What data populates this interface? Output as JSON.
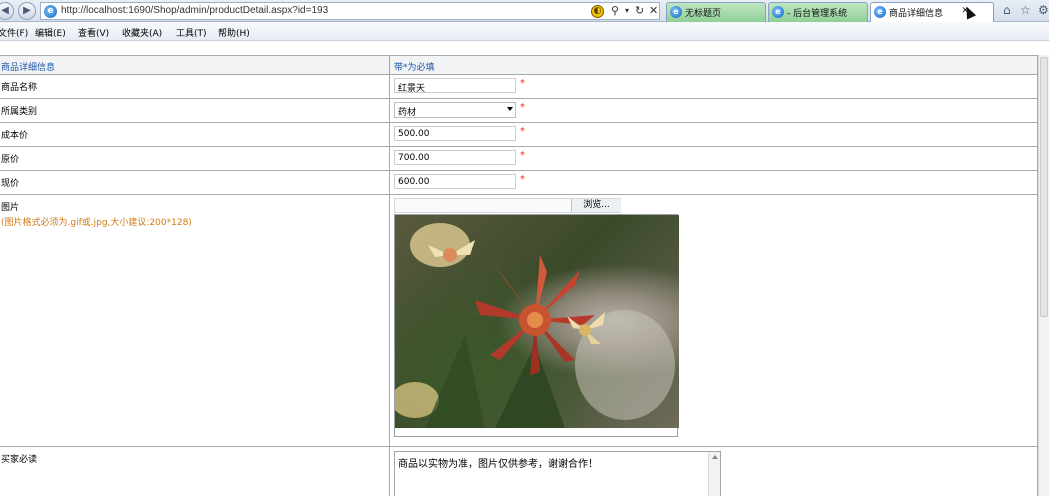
{
  "browser": {
    "url": "http://localhost:1690/Shop/admin/productDetail.aspx?id=193",
    "tabs": [
      {
        "label": "无标题页"
      },
      {
        "label": "- 后台管理系统"
      },
      {
        "label": "商品详细信息"
      }
    ],
    "menu": [
      "文件(F)",
      "编辑(E)",
      "查看(V)",
      "收藏夹(A)",
      "工具(T)",
      "帮助(H)"
    ]
  },
  "form": {
    "header_left": "商品详细信息",
    "header_right": "带*为必填",
    "required_mark": "*",
    "rows": [
      {
        "label": "商品名称",
        "value": "红景天"
      },
      {
        "label": "所属类别",
        "value": "药材"
      },
      {
        "label": "成本价",
        "value": "500.00"
      },
      {
        "label": "原价",
        "value": "700.00"
      },
      {
        "label": "现价",
        "value": "600.00"
      }
    ],
    "image_label": "图片",
    "image_hint": "(图片格式必须为.gif或.jpg,大小建议:200*128)",
    "browse_label": "浏览...",
    "notice_label": "买家必读",
    "notice_text": "商品以实物为准，图片仅供参考，谢谢合作！"
  },
  "colors": {
    "header_text": "#1a57a6",
    "required_star": "#e0391f",
    "hint_text": "#d07a12",
    "tab_green": "#8fd096"
  }
}
